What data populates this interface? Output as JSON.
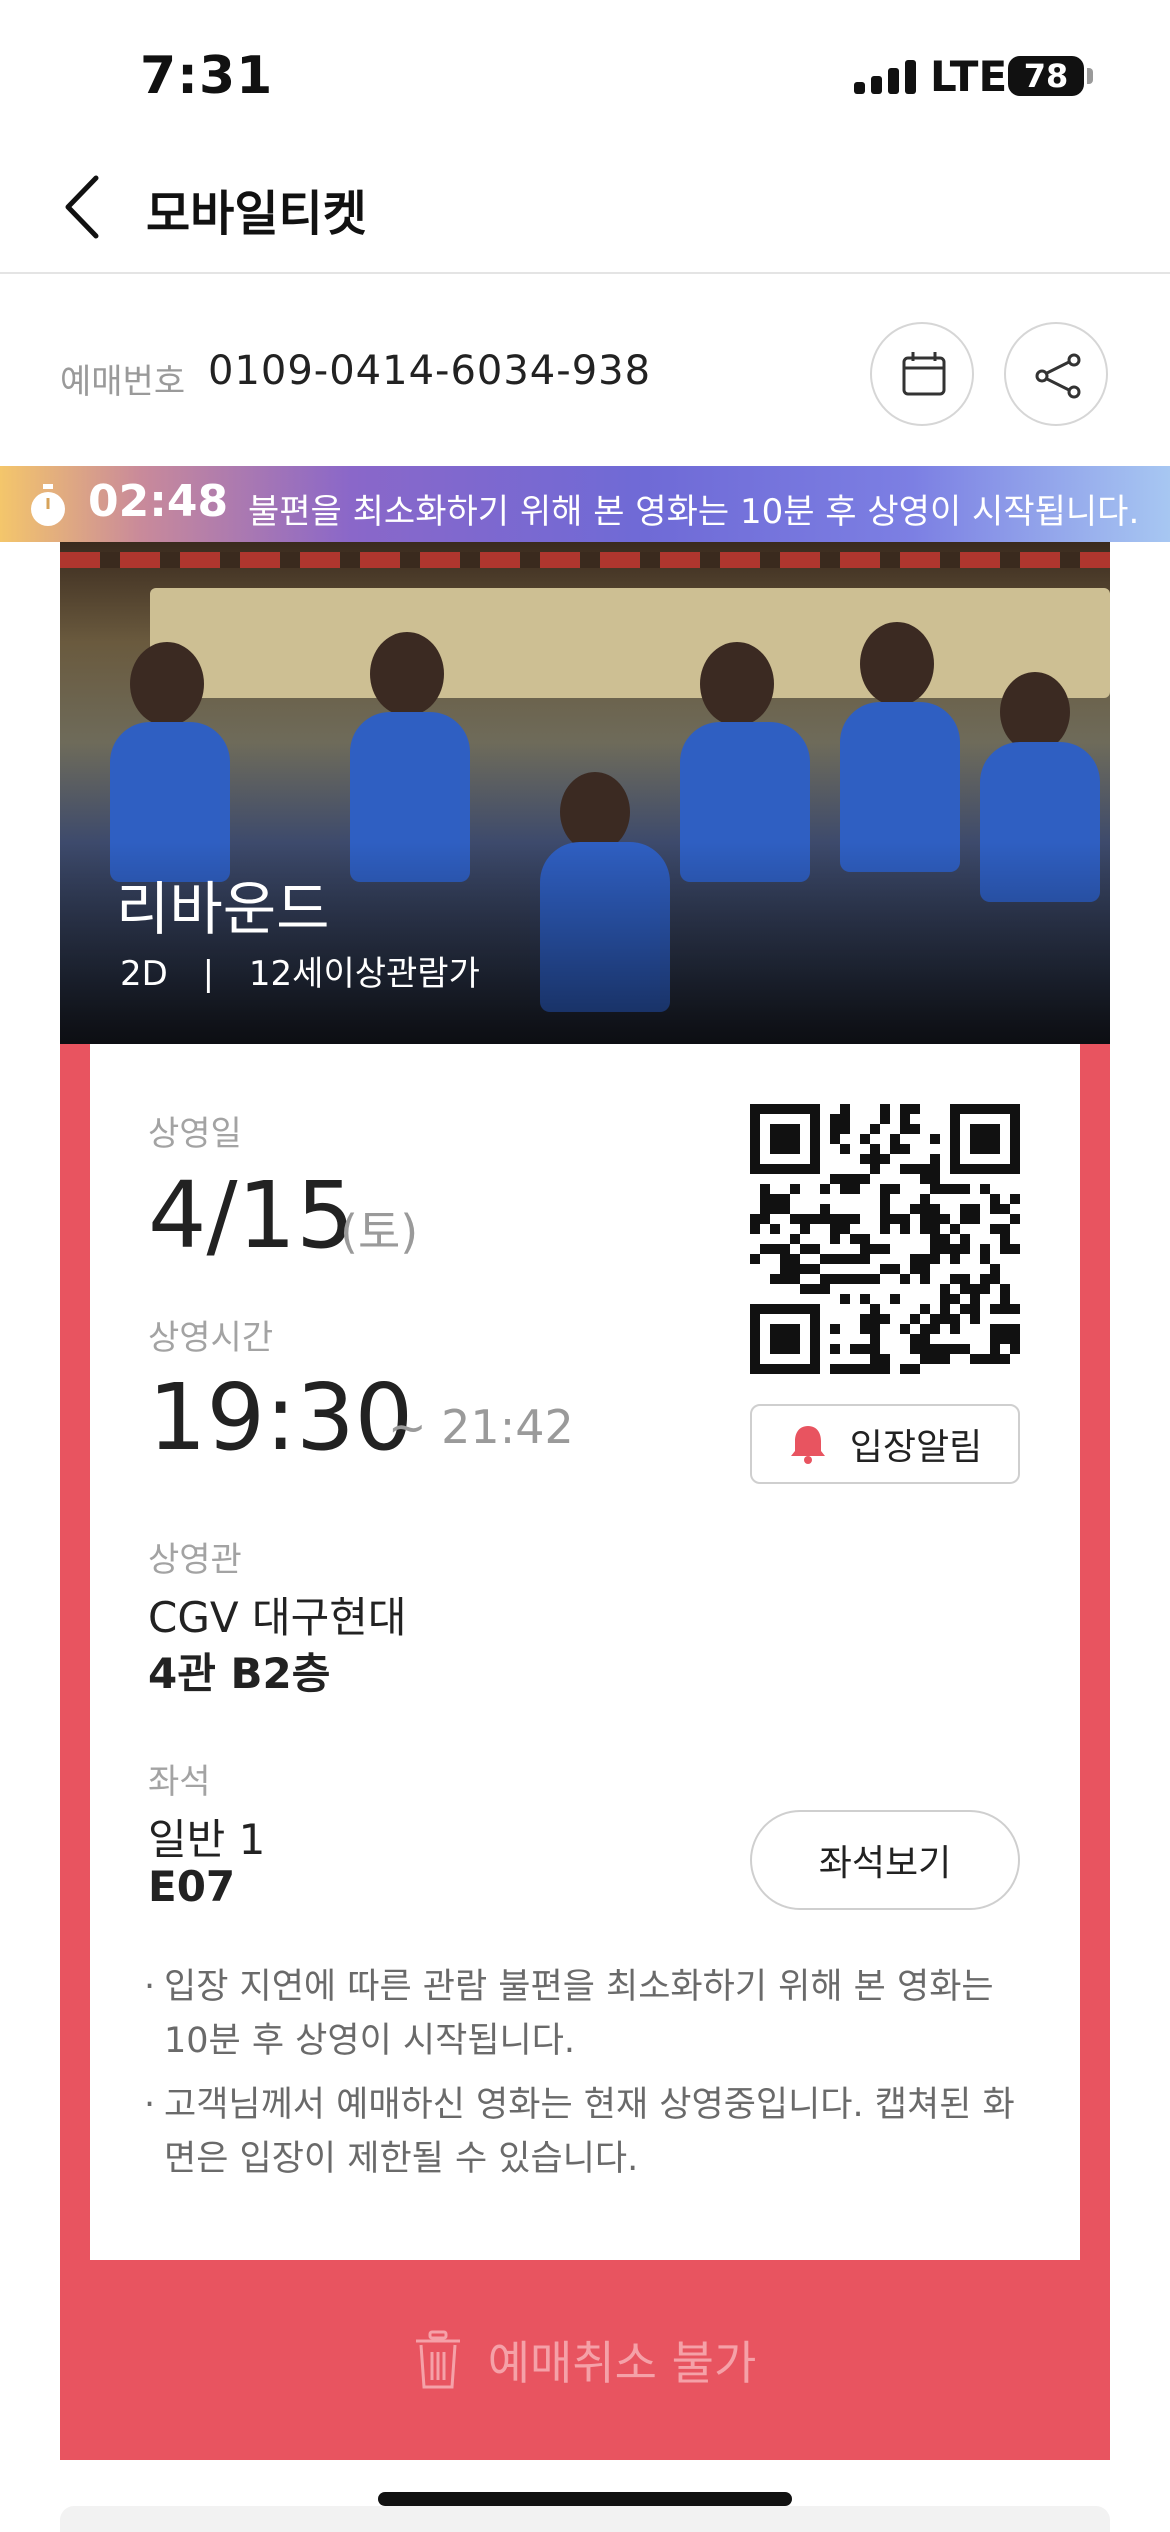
{
  "status_bar": {
    "time": "7:31",
    "network": "LTE",
    "battery": "78"
  },
  "nav": {
    "title": "모바일티켓"
  },
  "booking": {
    "label": "예매번호",
    "number": "0109-0414-6034-938"
  },
  "notice": {
    "countdown": "02:48",
    "text": "불편을 최소화하기 위해 본 영화는 10분 후 상영이 시작됩니다."
  },
  "movie": {
    "title": "리바운드",
    "format": "2D",
    "separator": "|",
    "rating": "12세이상관람가"
  },
  "ticket": {
    "date_label": "상영일",
    "date": "4/15",
    "day": "(토)",
    "time_label": "상영시간",
    "start_time": "19:30",
    "end_time": "~ 21:42",
    "theater_label": "상영관",
    "theater_name": "CGV 대구현대",
    "screen": "4관 B2층",
    "seat_label": "좌석",
    "seat_type": "일반 1",
    "seat_number": "E07",
    "entry_alert_button": "입장알림",
    "seat_view_button": "좌석보기",
    "notes": [
      "입장 지연에 따른 관람 불편을 최소화하기 위해 본 영화는 10분 후 상영이 시작됩니다.",
      "고객님께서 예매하신 영화는 현재 상영중입니다. 캡쳐된 화면은 입장이 제한될 수 있습니다."
    ]
  },
  "cancel": {
    "label": "예매취소 불가"
  },
  "colors": {
    "accent": "#e85460",
    "cancel_text": "#f5a1a8"
  }
}
